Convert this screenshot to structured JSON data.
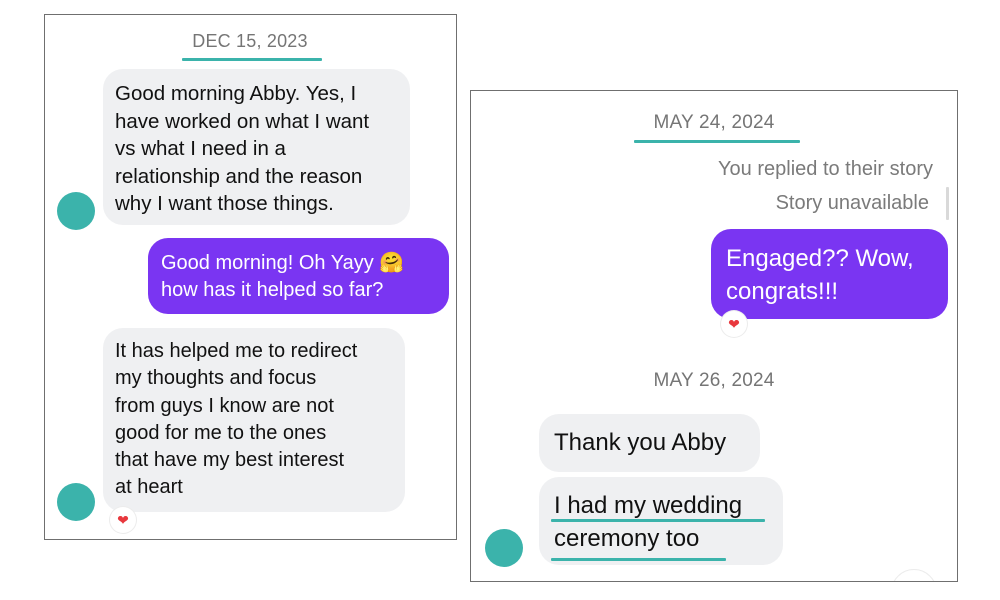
{
  "left_panel": {
    "date": "DEC 15, 2023",
    "messages": [
      {
        "direction": "incoming",
        "text": "Good morning Abby. Yes, I\nhave worked on what I want\nvs what I need in a\nrelationship and the reason\nwhy I want those things."
      },
      {
        "direction": "outgoing",
        "text": "Good morning! Oh Yayy 🤗\nhow has it helped so far?"
      },
      {
        "direction": "incoming",
        "text": "It has helped me to redirect\nmy thoughts and focus\nfrom guys I know are not\ngood for me to the ones\nthat have my best interest\nat heart"
      }
    ],
    "reaction": "❤"
  },
  "right_panel": {
    "date_1": "MAY 24, 2024",
    "story_reply_label": "You replied to their story",
    "story_unavailable": "Story unavailable",
    "outgoing_message": "Engaged?? Wow,\ncongrats!!!",
    "reaction": "❤",
    "date_2": "MAY 26, 2024",
    "incoming_messages": [
      {
        "text": "Thank you Abby"
      },
      {
        "text": "I had my wedding\nceremony too"
      }
    ]
  },
  "colors": {
    "accent_teal": "#3bb3ab",
    "outgoing_bubble": "#7a35f2",
    "incoming_bubble": "#eff0f2",
    "heart": "#e8383d"
  },
  "icons": {
    "reaction": "heart-icon",
    "avatar": "avatar-circle"
  }
}
